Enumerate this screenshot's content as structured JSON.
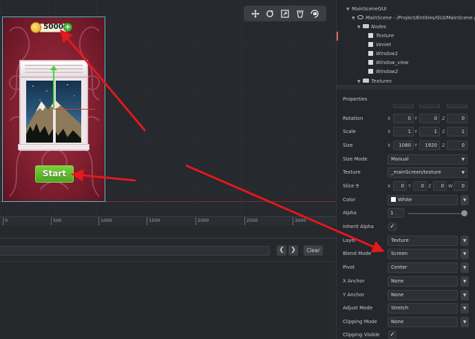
{
  "game": {
    "coins": "5000",
    "coin_plus": "+",
    "start_label": "Start"
  },
  "ruler": {
    "ticks": [
      "0",
      "500",
      "1000",
      "1500",
      "2000",
      "2500",
      "3000"
    ]
  },
  "console": {
    "prev": "❮",
    "next": "❯",
    "clear_label": "Clear"
  },
  "outline": {
    "root": "MainSceneGUI",
    "scene": "MainScene - /Project/Entities/GUI/MainScene.gui",
    "nodes_folder": "Nodes",
    "nodes": [
      "Texture",
      "Veniet",
      "Window1",
      "Window_view",
      "Window2"
    ],
    "textures_folder": "Textures"
  },
  "properties": {
    "title": "Properties",
    "rotation": {
      "label": "Rotation",
      "x": "0",
      "y": "0",
      "z": "0"
    },
    "scale": {
      "label": "Scale",
      "x": "1",
      "y": "1",
      "z": "1"
    },
    "size": {
      "label": "Size",
      "x": "1080",
      "y": "1920",
      "z": "0"
    },
    "size_mode": {
      "label": "Size Mode",
      "value": "Manual"
    },
    "texture": {
      "label": "Texture",
      "value": "_mainScreen/texture"
    },
    "slice9": {
      "label": "Slice 9",
      "x": "0",
      "y": "0",
      "z": "0",
      "w": "0"
    },
    "color": {
      "label": "Color",
      "value": "White"
    },
    "alpha": {
      "label": "Alpha",
      "value": "1"
    },
    "inherit_alpha": {
      "label": "Inherit Alpha"
    },
    "layer": {
      "label": "Layer",
      "value": "Texture"
    },
    "blend_mode": {
      "label": "Blend Mode",
      "value": "Screen"
    },
    "pivot": {
      "label": "Pivot",
      "value": "Center"
    },
    "x_anchor": {
      "label": "X Anchor",
      "value": "None"
    },
    "y_anchor": {
      "label": "Y Anchor",
      "value": "None"
    },
    "adjust_mode": {
      "label": "Adjust Mode",
      "value": "Stretch"
    },
    "clipping_mode": {
      "label": "Clipping Mode",
      "value": "None"
    },
    "clipping_visible": {
      "label": "Clipping Visible"
    }
  },
  "axis_labels": {
    "x": "X",
    "y": "Y",
    "z": "Z",
    "w": "W"
  },
  "icons": {
    "move": "move-icon",
    "rotate": "rotate-icon",
    "scale": "scale-icon",
    "visibility": "visibility-icon",
    "camera": "camera-icon"
  },
  "colors": {
    "accent_annotation": "#e3191c",
    "selection": "#52c3c9",
    "start_button": "#5cb52b"
  }
}
